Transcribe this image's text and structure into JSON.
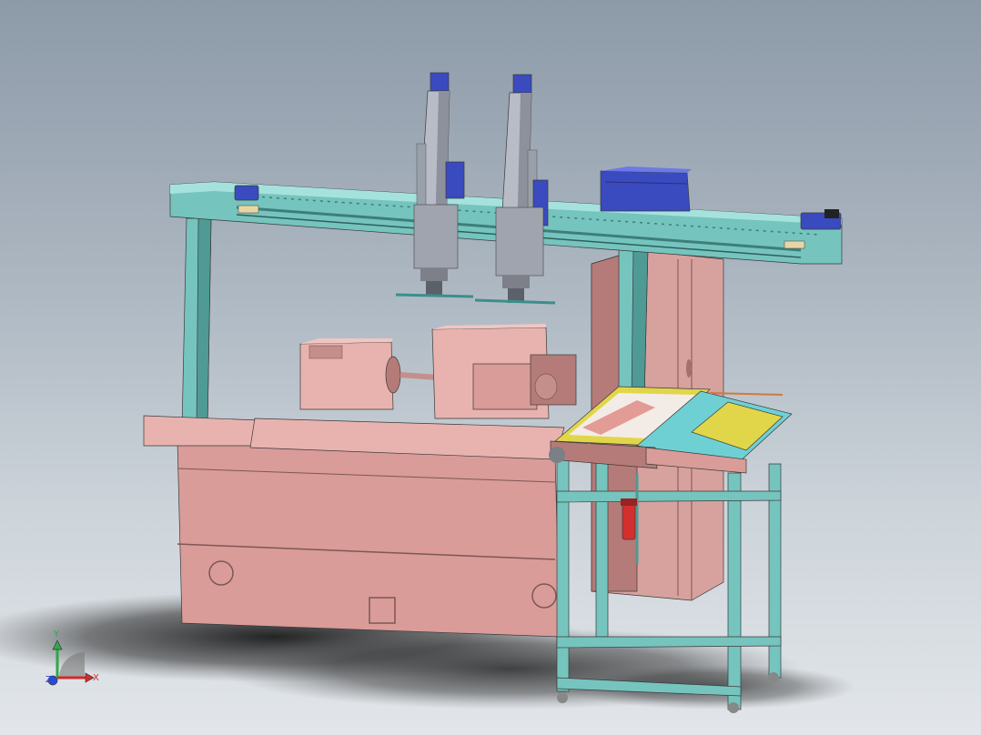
{
  "viewport": {
    "background_top": "#8d9aa8",
    "background_bottom": "#e2e6ea"
  },
  "colors": {
    "frame": "#76c4be",
    "frame_dark": "#4f9a95",
    "machine": "#d99c99",
    "machine_dark": "#b57b78",
    "machine_light": "#e8b3af",
    "cabinet": "#d7a29e",
    "actuator": "#b8bcc6",
    "motor_blue": "#3a4bbf",
    "tray_yellow": "#e1d64a",
    "tray_cyan": "#6fd0d4",
    "regulator_red": "#d32f2f"
  },
  "triad": {
    "x_label": "X",
    "y_label": "Y",
    "z_label": "Z",
    "x_color": "#d22b2b",
    "y_color": "#2fa84a",
    "z_color": "#2a4bd6"
  }
}
